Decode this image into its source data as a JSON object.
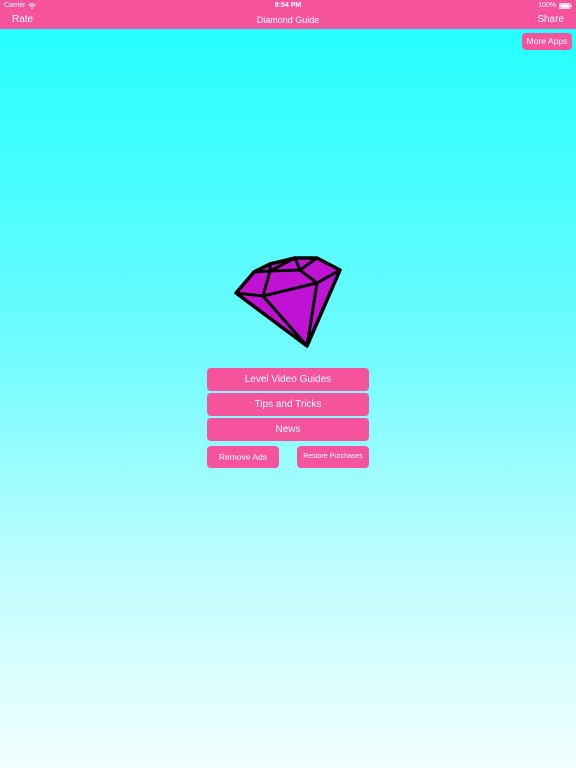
{
  "status_bar": {
    "carrier": "Carrier",
    "time": "8:54 PM",
    "battery": "100%"
  },
  "nav": {
    "left_label": "Rate",
    "title": "Diamond Guide",
    "right_label": "Share"
  },
  "more_apps_label": "More Apps",
  "menu": {
    "level_video_guides": "Level Video Guides",
    "tips_and_tricks": "Tips and Tricks",
    "news": "News",
    "remove_ads": "Remove Ads",
    "restore_purchases": "Restore Purchases"
  },
  "colors": {
    "accent": "#f6539d",
    "background_top": "#1effff",
    "background_bottom": "#f2ffff",
    "diamond_fill": "#c012d4",
    "diamond_stroke": "#000000"
  },
  "icons": {
    "wifi": "wifi-icon",
    "battery": "battery-icon",
    "logo": "diamond-icon"
  }
}
